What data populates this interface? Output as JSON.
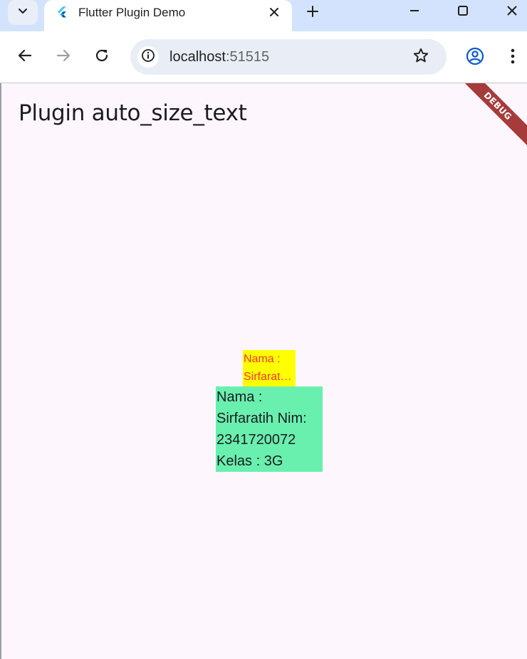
{
  "browser": {
    "tab": {
      "title": "Flutter Plugin Demo"
    },
    "address_bar": {
      "host": "localhost",
      "port": ":51515"
    }
  },
  "app": {
    "title": "Plugin auto_size_text",
    "debug_banner": "DEBUG",
    "auto_size_text": {
      "lines": [
        "Nama :",
        "Sirfarat…"
      ]
    },
    "info_text": {
      "lines": [
        "Nama :",
        "Sirfaratih Nim:",
        "2341720072",
        "Kelas : 3G"
      ]
    }
  },
  "colors": {
    "tabstrip": "#d3e3fd",
    "page_background": "#fdf6fd",
    "auto_size_box": "#ffff00",
    "auto_size_text": "#f43636",
    "info_box": "#69f0ae",
    "debug_banner": "#a63b3b"
  },
  "icons": {
    "tab_search": "chevron-down-icon",
    "favicon": "flutter-icon",
    "tab_close": "close-icon",
    "new_tab": "plus-icon",
    "minimize": "minimize-icon",
    "maximize": "maximize-icon",
    "window_close": "close-icon",
    "back": "arrow-left-icon",
    "forward": "arrow-right-icon",
    "reload": "reload-icon",
    "site_info": "info-icon",
    "bookmark": "star-icon",
    "profile": "profile-icon",
    "menu": "more-vert-icon"
  }
}
